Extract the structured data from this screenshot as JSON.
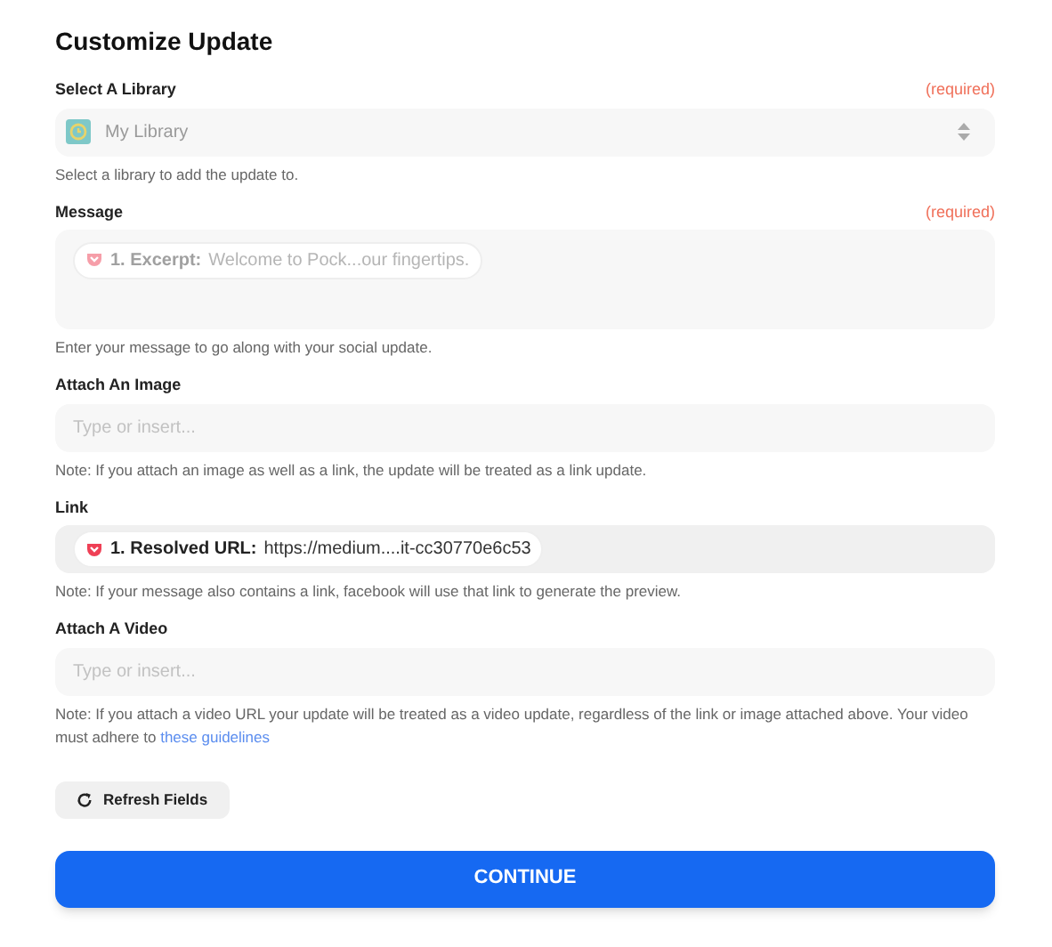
{
  "title": "Customize Update",
  "fields": [
    {
      "kind": "select",
      "label": "Select A Library",
      "required": "(required)",
      "value": "My Library",
      "disabled": true,
      "help": "Select a library to add the update to."
    },
    {
      "kind": "textarea",
      "label": "Message",
      "required": "(required)",
      "disabled": true,
      "pill": {
        "label": "1. Excerpt:",
        "value": "Welcome to Pock...our fingertips."
      },
      "help": "Enter your message to go along with your social update."
    },
    {
      "kind": "input",
      "label": "Attach An Image",
      "placeholder": "Type or insert...",
      "disabled": false,
      "help": "Note: If you attach an image as well as a link, the update will be treated as a link update."
    },
    {
      "kind": "input",
      "label": "Link",
      "disabled": false,
      "pill": {
        "label": "1. Resolved URL:",
        "value": "https://medium....it-cc30770e6c53"
      },
      "help": "Note: If your message also contains a link, facebook will use that link to generate the preview."
    },
    {
      "kind": "input",
      "label": "Attach A Video",
      "placeholder": "Type or insert...",
      "disabled": false,
      "help": "Note: If you attach a video URL your update will be treated as a video update, regardless of the link or image attached above. Your video must adhere to",
      "help_link": "these guidelines"
    }
  ],
  "refresh_button": "Refresh Fields",
  "continue_button": "CONTINUE"
}
